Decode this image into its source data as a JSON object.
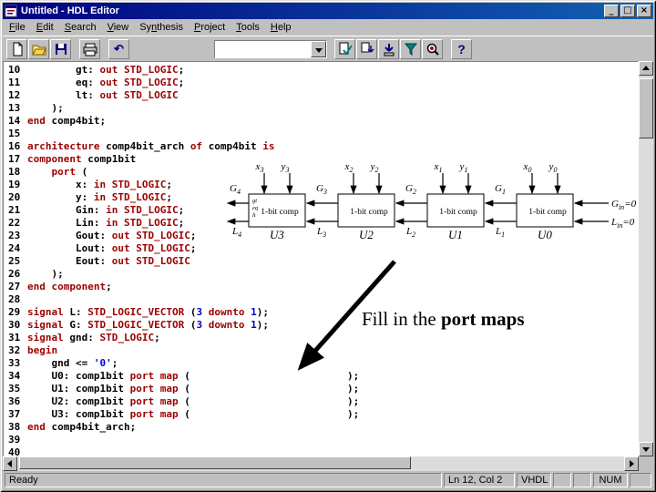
{
  "window": {
    "title": "Untitled - HDL Editor"
  },
  "menu": {
    "items": [
      {
        "label": "File",
        "accel": 0
      },
      {
        "label": "Edit",
        "accel": 0
      },
      {
        "label": "Search",
        "accel": 0
      },
      {
        "label": "View",
        "accel": 0
      },
      {
        "label": "Synthesis",
        "accel": 2
      },
      {
        "label": "Project",
        "accel": 0
      },
      {
        "label": "Tools",
        "accel": 0
      },
      {
        "label": "Help",
        "accel": 0
      }
    ]
  },
  "toolbar": {
    "module_selector_value": "",
    "buttons": [
      "new-file",
      "open-file",
      "save",
      "print",
      "undo",
      "module-selector",
      "check-syntax",
      "add-to-project",
      "import-template",
      "synthesize",
      "view-report",
      "help"
    ]
  },
  "editor": {
    "colors": {
      "keyword": "#9c0000",
      "plain": "#000000",
      "literal": "#0000cc"
    },
    "lines": [
      {
        "n": 10,
        "s": [
          [
            "        gt: ",
            "b"
          ],
          [
            "out STD_LOGIC",
            "r"
          ],
          [
            ";",
            "b"
          ]
        ]
      },
      {
        "n": 11,
        "s": [
          [
            "        eq: ",
            "b"
          ],
          [
            "out STD_LOGIC",
            "r"
          ],
          [
            ";",
            "b"
          ]
        ]
      },
      {
        "n": 12,
        "s": [
          [
            "        lt: ",
            "b"
          ],
          [
            "out STD_LOGIC",
            "r"
          ]
        ]
      },
      {
        "n": 13,
        "s": [
          [
            "    );",
            "b"
          ]
        ]
      },
      {
        "n": 14,
        "s": [
          [
            "end ",
            "r"
          ],
          [
            "comp4bit;",
            "b"
          ]
        ]
      },
      {
        "n": 15,
        "s": []
      },
      {
        "n": 16,
        "s": [
          [
            "architecture ",
            "r"
          ],
          [
            "comp4bit_arch ",
            "b"
          ],
          [
            "of ",
            "r"
          ],
          [
            "comp4bit ",
            "b"
          ],
          [
            "is",
            "r"
          ]
        ]
      },
      {
        "n": 17,
        "s": [
          [
            "component ",
            "r"
          ],
          [
            "comp1bit",
            "b"
          ]
        ]
      },
      {
        "n": 18,
        "s": [
          [
            "    ",
            "b"
          ],
          [
            "port",
            "r"
          ],
          [
            " (",
            "b"
          ]
        ]
      },
      {
        "n": 19,
        "s": [
          [
            "        x: ",
            "b"
          ],
          [
            "in STD_LOGIC",
            "r"
          ],
          [
            ";",
            "b"
          ]
        ]
      },
      {
        "n": 20,
        "s": [
          [
            "        y: ",
            "b"
          ],
          [
            "in STD_LOGIC",
            "r"
          ],
          [
            ";",
            "b"
          ]
        ]
      },
      {
        "n": 21,
        "s": [
          [
            "        Gin: ",
            "b"
          ],
          [
            "in STD_LOGIC",
            "r"
          ],
          [
            ";",
            "b"
          ]
        ]
      },
      {
        "n": 22,
        "s": [
          [
            "        Lin: ",
            "b"
          ],
          [
            "in STD_LOGIC",
            "r"
          ],
          [
            ";",
            "b"
          ]
        ]
      },
      {
        "n": 23,
        "s": [
          [
            "        Gout: ",
            "b"
          ],
          [
            "out STD_LOGIC",
            "r"
          ],
          [
            ";",
            "b"
          ]
        ]
      },
      {
        "n": 24,
        "s": [
          [
            "        Lout: ",
            "b"
          ],
          [
            "out STD_LOGIC",
            "r"
          ],
          [
            ";",
            "b"
          ]
        ]
      },
      {
        "n": 25,
        "s": [
          [
            "        Eout: ",
            "b"
          ],
          [
            "out STD_LOGIC",
            "r"
          ]
        ]
      },
      {
        "n": 26,
        "s": [
          [
            "    );",
            "b"
          ]
        ]
      },
      {
        "n": 27,
        "s": [
          [
            "end component",
            "r"
          ],
          [
            ";",
            "b"
          ]
        ]
      },
      {
        "n": 28,
        "s": []
      },
      {
        "n": 29,
        "s": [
          [
            "signal ",
            "r"
          ],
          [
            "L: ",
            "b"
          ],
          [
            "STD_LOGIC_VECTOR ",
            "r"
          ],
          [
            "(",
            "b"
          ],
          [
            "3",
            "u"
          ],
          [
            " ",
            "b"
          ],
          [
            "downto",
            "r"
          ],
          [
            " ",
            "b"
          ],
          [
            "1",
            "u"
          ],
          [
            ");",
            "b"
          ]
        ]
      },
      {
        "n": 30,
        "s": [
          [
            "signal ",
            "r"
          ],
          [
            "G: ",
            "b"
          ],
          [
            "STD_LOGIC_VECTOR ",
            "r"
          ],
          [
            "(",
            "b"
          ],
          [
            "3",
            "u"
          ],
          [
            " ",
            "b"
          ],
          [
            "downto",
            "r"
          ],
          [
            " ",
            "b"
          ],
          [
            "1",
            "u"
          ],
          [
            ");",
            "b"
          ]
        ]
      },
      {
        "n": 31,
        "s": [
          [
            "signal ",
            "r"
          ],
          [
            "gnd: ",
            "b"
          ],
          [
            "STD_LOGIC",
            "r"
          ],
          [
            ";",
            "b"
          ]
        ]
      },
      {
        "n": 32,
        "s": [
          [
            "begin",
            "r"
          ]
        ]
      },
      {
        "n": 33,
        "s": [
          [
            "    gnd <= ",
            "b"
          ],
          [
            "'0'",
            "u"
          ],
          [
            ";",
            "b"
          ]
        ]
      },
      {
        "n": 34,
        "s": [
          [
            "    U0: comp1bit ",
            "b"
          ],
          [
            "port map",
            "r"
          ],
          [
            " (                          );",
            "b"
          ]
        ]
      },
      {
        "n": 35,
        "s": [
          [
            "    U1: comp1bit ",
            "b"
          ],
          [
            "port map",
            "r"
          ],
          [
            " (                          );",
            "b"
          ]
        ]
      },
      {
        "n": 36,
        "s": [
          [
            "    U2: comp1bit ",
            "b"
          ],
          [
            "port map",
            "r"
          ],
          [
            " (                          );",
            "b"
          ]
        ]
      },
      {
        "n": 37,
        "s": [
          [
            "    U3: comp1bit ",
            "b"
          ],
          [
            "port map",
            "r"
          ],
          [
            " (                          );",
            "b"
          ]
        ]
      },
      {
        "n": 38,
        "s": [
          [
            "end ",
            "r"
          ],
          [
            "comp4bit_arch;",
            "b"
          ]
        ]
      },
      {
        "n": 39,
        "s": []
      },
      {
        "n": 40,
        "s": []
      }
    ]
  },
  "diagram": {
    "blocks": [
      {
        "title": "1-bit comp",
        "name": "U3",
        "inputs": [
          {
            "b": "x",
            "s": "3"
          },
          {
            "b": "y",
            "s": "3"
          }
        ]
      },
      {
        "title": "1-bit comp",
        "name": "U2",
        "inputs": [
          {
            "b": "x",
            "s": "2"
          },
          {
            "b": "y",
            "s": "2"
          }
        ]
      },
      {
        "title": "1-bit comp",
        "name": "U1",
        "inputs": [
          {
            "b": "x",
            "s": "1"
          },
          {
            "b": "y",
            "s": "1"
          }
        ]
      },
      {
        "title": "1-bit comp",
        "name": "U0",
        "inputs": [
          {
            "b": "x",
            "s": "0"
          },
          {
            "b": "y",
            "s": "0"
          }
        ]
      }
    ],
    "g_labels": [
      {
        "b": "G",
        "s": "4"
      },
      {
        "b": "G",
        "s": "3"
      },
      {
        "b": "G",
        "s": "2"
      },
      {
        "b": "G",
        "s": "1"
      }
    ],
    "l_labels": [
      {
        "b": "L",
        "s": "4"
      },
      {
        "b": "L",
        "s": "3"
      },
      {
        "b": "L",
        "s": "2"
      },
      {
        "b": "L",
        "s": "1"
      }
    ],
    "right_labels": [
      {
        "b": "G",
        "s": "in",
        "r": "=0"
      },
      {
        "b": "L",
        "s": "in",
        "r": "=0"
      }
    ],
    "left_pins": [
      "gt",
      "eq",
      "lt"
    ],
    "annotation": {
      "normal": "Fill in the ",
      "bold": "port maps"
    }
  },
  "statusbar": {
    "ready": "Ready",
    "position": "Ln 12, Col 2",
    "mode": "VHDL",
    "empty1": "",
    "empty2": "",
    "num": "NUM",
    "empty3": ""
  }
}
